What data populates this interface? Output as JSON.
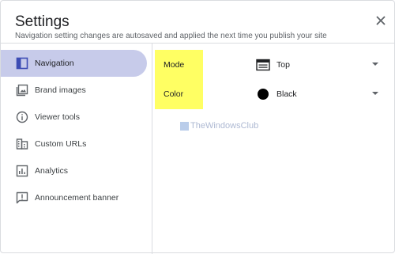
{
  "dialog": {
    "title": "Settings",
    "subtitle": "Navigation setting changes are autosaved and applied the next time you publish your site"
  },
  "sidebar": {
    "items": [
      {
        "label": "Navigation",
        "icon": "navigation-icon",
        "active": true
      },
      {
        "label": "Brand images",
        "icon": "image-icon",
        "active": false
      },
      {
        "label": "Viewer tools",
        "icon": "info-icon",
        "active": false
      },
      {
        "label": "Custom URLs",
        "icon": "domain-icon",
        "active": false
      },
      {
        "label": "Analytics",
        "icon": "analytics-icon",
        "active": false
      },
      {
        "label": "Announcement banner",
        "icon": "announcement-icon",
        "active": false
      }
    ]
  },
  "settings": {
    "mode": {
      "label": "Mode",
      "value": "Top",
      "icon": "top-nav-icon"
    },
    "color": {
      "label": "Color",
      "value": "Black",
      "icon": "color-dot-icon",
      "swatch": "#000000"
    }
  },
  "watermark": {
    "text": "TheWindowsClub"
  },
  "colors": {
    "active_bg": "#c7cbea",
    "highlight": "#ffff63",
    "accent": "#3c4cb4"
  }
}
